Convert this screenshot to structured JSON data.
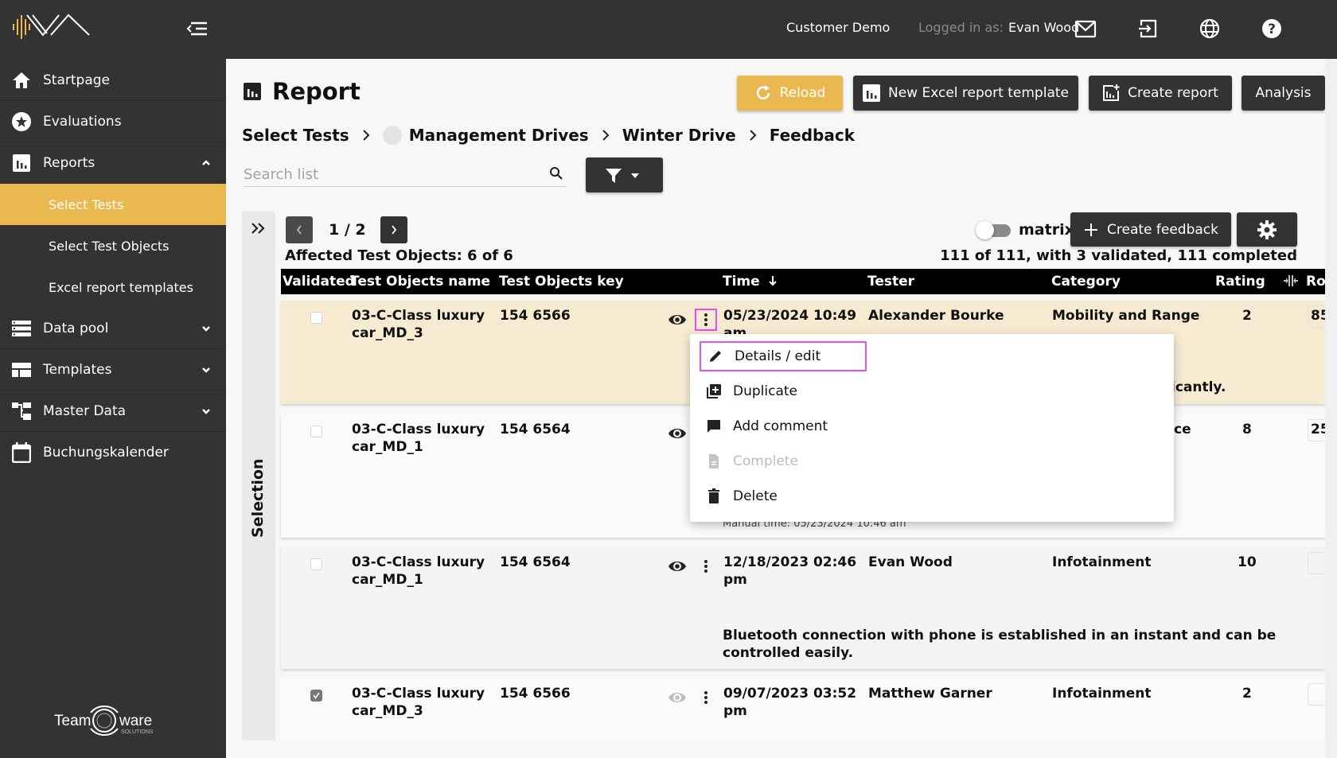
{
  "colors": {
    "sidebar_bg": "#333333",
    "accent": "#e9b84f",
    "highlight_row": "#f6ead1",
    "focus_outline": "#e94ee9"
  },
  "sidebar": {
    "collapse_icon": "menu-collapse-icon",
    "items": [
      {
        "label": "Startpage",
        "icon": "home-icon"
      },
      {
        "label": "Evaluations",
        "icon": "star-circle-icon"
      },
      {
        "label": "Reports",
        "icon": "bar-chart-icon",
        "expanded": true,
        "children": [
          {
            "label": "Select Tests",
            "active": true
          },
          {
            "label": "Select Test Objects"
          },
          {
            "label": "Excel report templates"
          }
        ]
      },
      {
        "label": "Data pool",
        "icon": "database-icon",
        "expanded": false
      },
      {
        "label": "Templates",
        "icon": "template-icon",
        "expanded": false
      },
      {
        "label": "Master Data",
        "icon": "hierarchy-icon",
        "expanded": false
      },
      {
        "label": "Buchungskalender",
        "icon": "calendar-icon"
      }
    ],
    "footer_logo": "Teamware Solutions"
  },
  "topbar": {
    "customer": "Customer Demo",
    "logged_in_label": "Logged in as:",
    "user": "Evan Wood",
    "icons": [
      "mail-icon",
      "logout-icon",
      "globe-icon",
      "help-icon"
    ]
  },
  "header": {
    "title": "Report",
    "buttons": {
      "reload": "Reload",
      "new_excel": "New Excel report template",
      "create_report": "Create report",
      "analysis": "Analysis"
    }
  },
  "breadcrumb": [
    "Select Tests",
    "Management Drives",
    "Winter Drive",
    "Feedback"
  ],
  "search": {
    "placeholder": "Search list",
    "value": ""
  },
  "selection_panel": {
    "label": "Selection"
  },
  "pager": {
    "current": 1,
    "total": 2,
    "text": "1 / 2"
  },
  "affected": "Affected Test Objects: 6 of 6",
  "summary": "111 of 111, with 3 validated, 111 completed",
  "matrix": {
    "label": "matrix",
    "on": false
  },
  "create_feedback": "Create feedback",
  "table": {
    "columns": [
      "Validated",
      "Test Objects name",
      "Test Objects key",
      "Time",
      "Tester",
      "Category",
      "Rating",
      "Ro"
    ],
    "sort": {
      "column": "Time",
      "direction": "desc"
    },
    "rows": [
      {
        "validated": false,
        "name_line1": "03-C-Class luxury",
        "name_line2": "car_MD_3",
        "key": "154 6566",
        "time_line1": "05/23/2024 10:49",
        "time_line2": "am",
        "tester": "Alexander Bourke",
        "category": "Mobility and Range",
        "rating": "2",
        "ro": "85",
        "comment_fragment": "icantly.",
        "highlighted": true,
        "eye_active": true
      },
      {
        "validated": false,
        "name_line1": "03-C-Class luxury",
        "name_line2": "car_MD_1",
        "key": "154 6564",
        "time_line1": "",
        "time_line2": "",
        "tester": "",
        "category_fragment": "ce",
        "rating": "8",
        "ro": "25",
        "subnote": "Manual time: 05/23/2024 10:46 am",
        "highlighted": false,
        "eye_active": true
      },
      {
        "validated": false,
        "name_line1": "03-C-Class luxury",
        "name_line2": "car_MD_1",
        "key": "154 6564",
        "time_line1": "12/18/2023 02:46",
        "time_line2": "pm",
        "tester": "Evan Wood",
        "category": "Infotainment",
        "rating": "10",
        "ro": "",
        "comment": "Bluetooth connection with phone is established in an instant and can be controlled easily.",
        "highlighted": false,
        "eye_active": true
      },
      {
        "validated": true,
        "name_line1": "03-C-Class luxury",
        "name_line2": "car_MD_3",
        "key": "154 6566",
        "time_line1": "09/07/2023 03:52",
        "time_line2": "pm",
        "tester": "Matthew Garner",
        "category": "Infotainment",
        "rating": "2",
        "ro": "",
        "highlighted": false,
        "eye_active": false
      }
    ]
  },
  "context_menu": {
    "items": [
      {
        "label": "Details / edit",
        "icon": "pencil-icon",
        "focused": true
      },
      {
        "label": "Duplicate",
        "icon": "duplicate-icon"
      },
      {
        "label": "Add comment",
        "icon": "comment-icon"
      },
      {
        "label": "Complete",
        "icon": "document-icon",
        "disabled": true
      },
      {
        "label": "Delete",
        "icon": "trash-icon"
      }
    ]
  }
}
